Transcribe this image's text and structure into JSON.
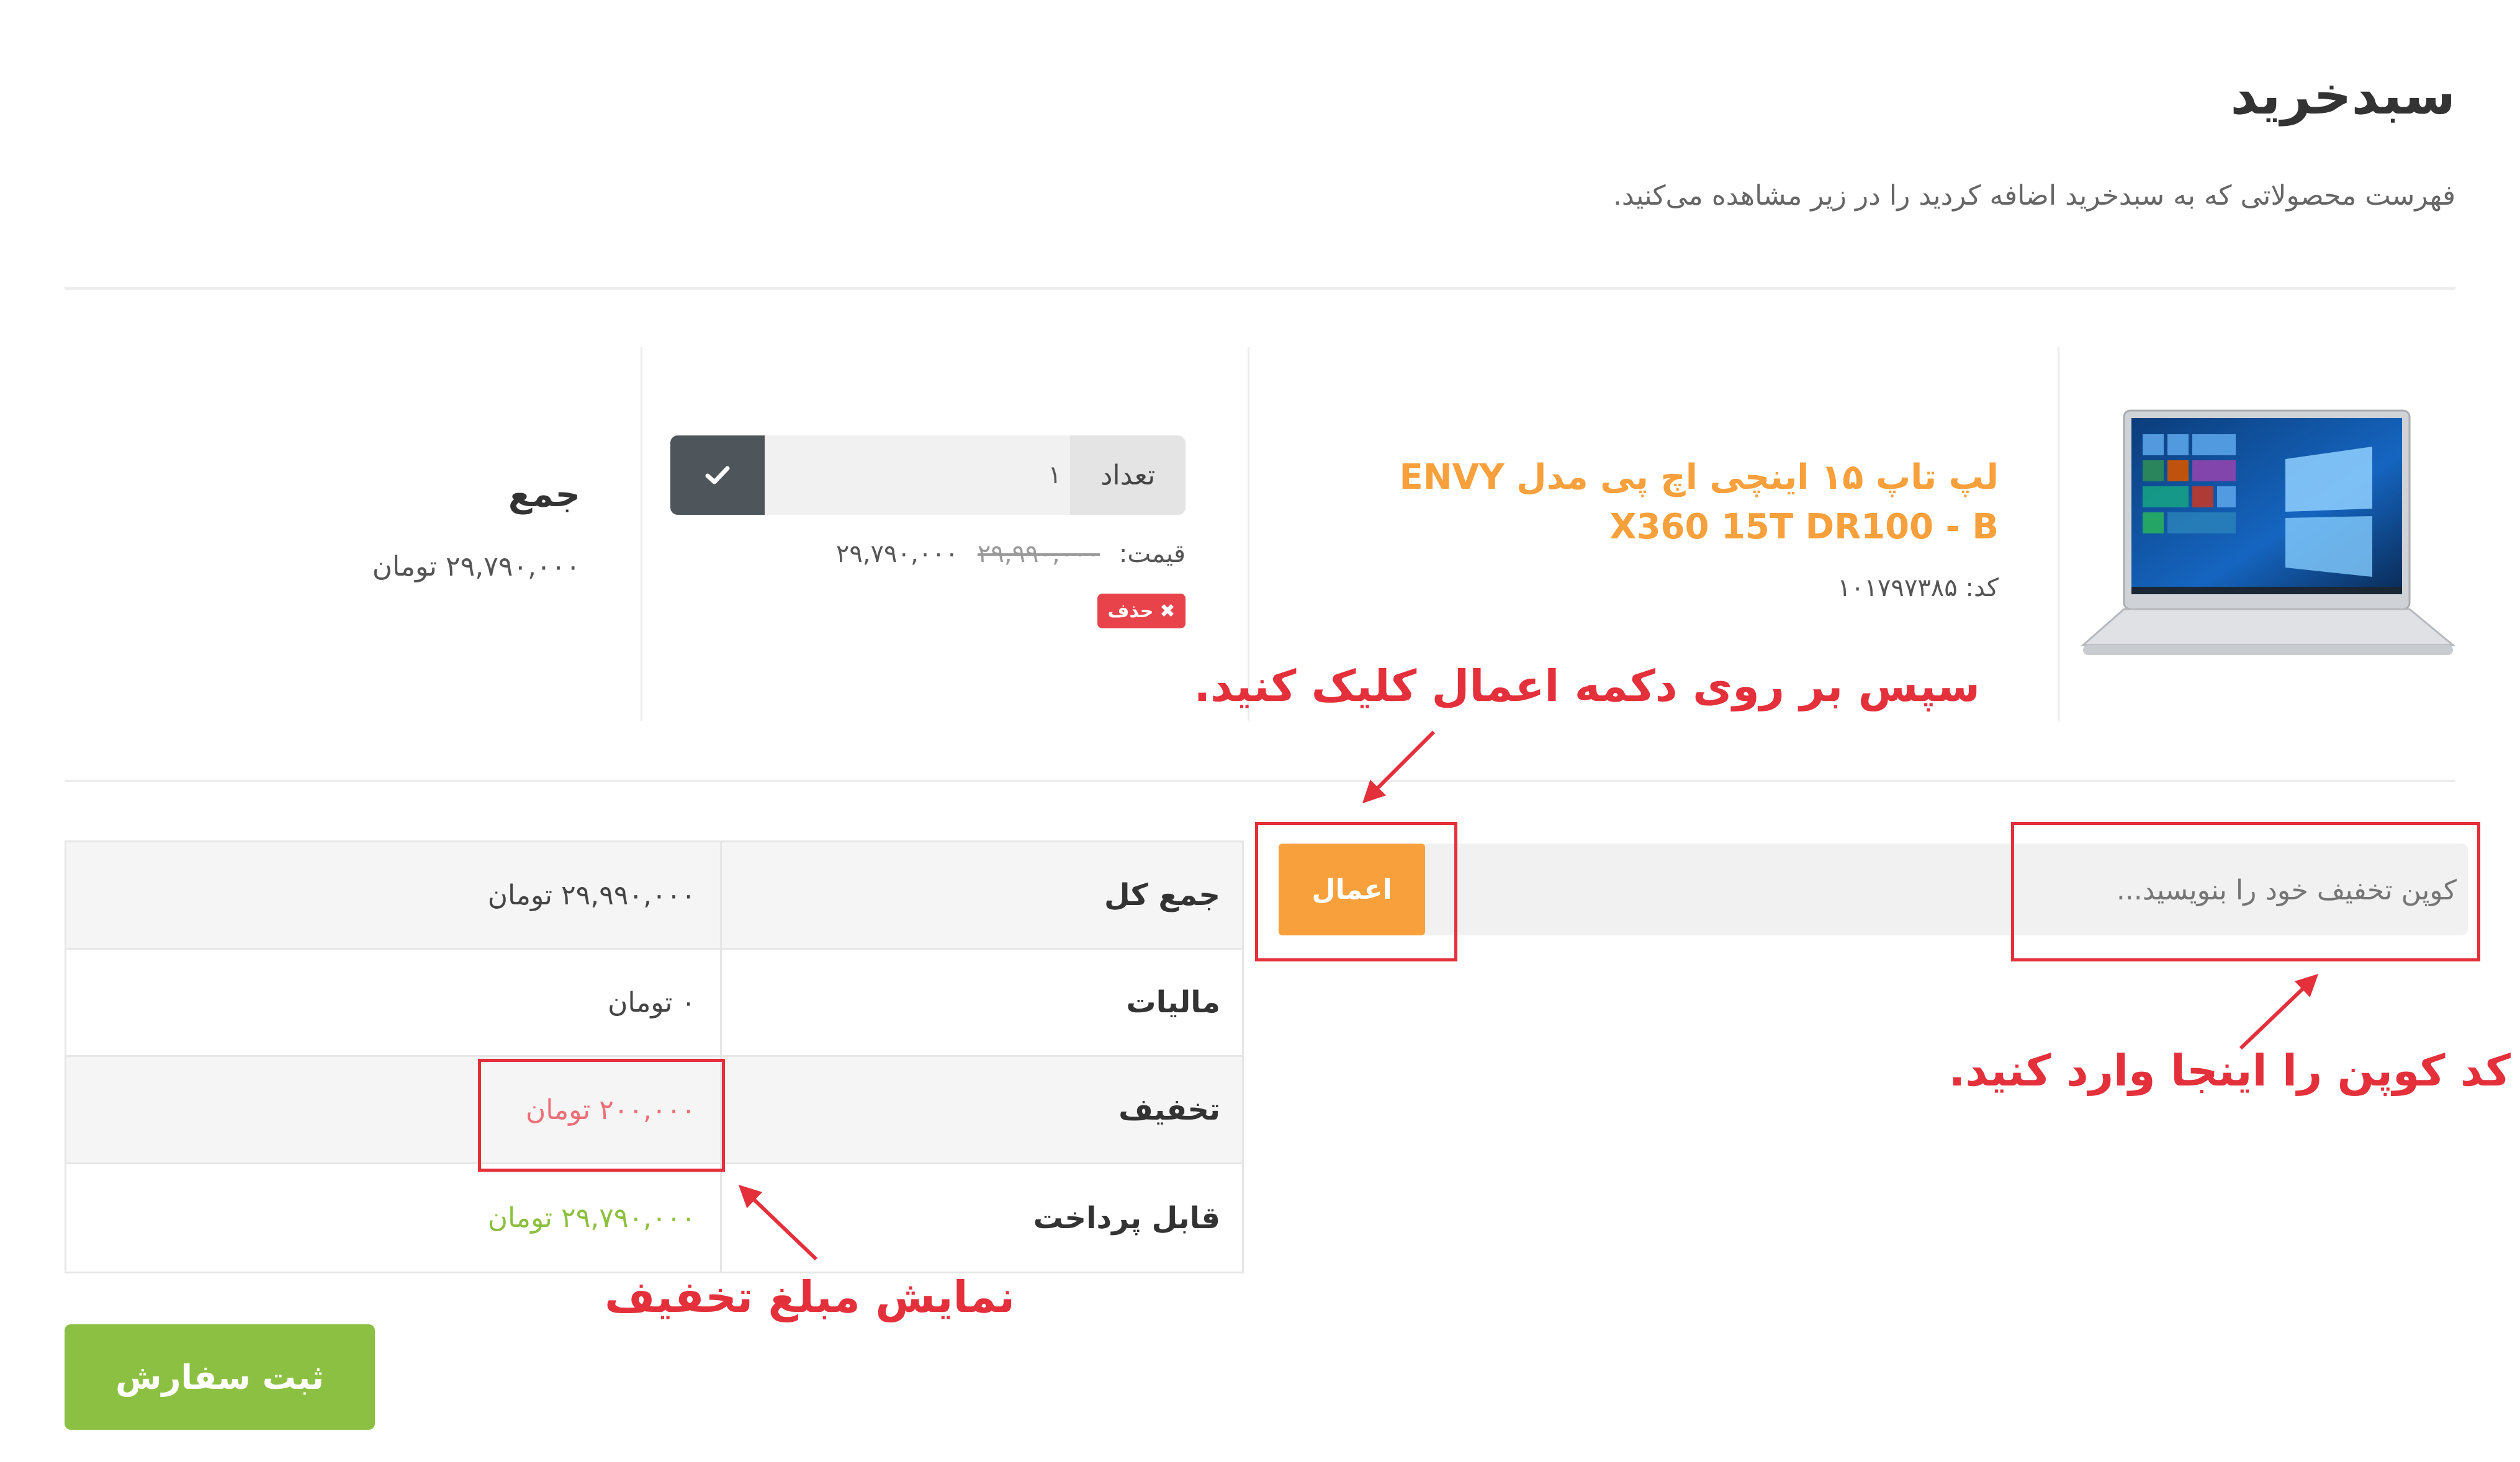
{
  "header": {
    "title": "سبدخرید",
    "subtitle": "فهرست محصولاتی که به سبدخرید اضافه کردید را در زیر مشاهده می‌کنید."
  },
  "product": {
    "name": "لپ تاپ ۱۵ اینچی اچ پی مدل ENVY X360 15T DR100 - B",
    "code_label": "کد:",
    "code": "۱۰۱۷۹۷۳۸۵",
    "quantity_label": "تعداد",
    "quantity": "۱",
    "price_label": "قیمت:",
    "old_price": "۲۹,۹۹۰,۰۰۰",
    "new_price": "۲۹,۷۹۰,۰۰۰",
    "delete_label": "حذف",
    "sum_label": "جمع",
    "sum_value": "۲۹,۷۹۰,۰۰۰ تومان"
  },
  "totals": {
    "rows": [
      {
        "label": "جمع کل",
        "value": "۲۹,۹۹۰,۰۰۰ تومان"
      },
      {
        "label": "مالیات",
        "value": "۰ تومان"
      },
      {
        "label": "تخفیف",
        "value": "۲۰۰,۰۰۰ تومان"
      },
      {
        "label": "قابل پرداخت",
        "value": "۲۹,۷۹۰,۰۰۰ تومان"
      }
    ]
  },
  "coupon": {
    "placeholder": "کوپن تخفیف خود را بنویسید...",
    "apply_label": "اعمال"
  },
  "submit_label": "ثبت سفارش",
  "annotations": {
    "apply": "سپس بر روی دکمه اعمال کلیک کنید.",
    "coupon": "کد کوپن را اینجا وارد کنید.",
    "discount": "نمایش مبلغ تخفیف"
  },
  "colors": {
    "accent_orange": "#f7a03c",
    "submit_green": "#8cc043",
    "danger_red": "#e8434b",
    "annotation_red": "#e4303b"
  }
}
